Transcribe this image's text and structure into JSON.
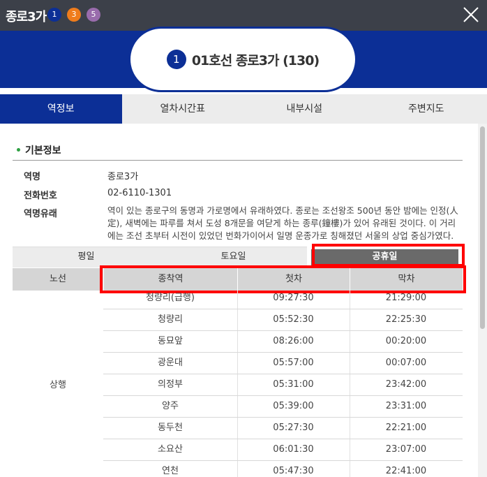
{
  "header": {
    "title": "종로3가",
    "lines": [
      {
        "label": "1",
        "color": "#0c2f96"
      },
      {
        "label": "3",
        "color": "#ef7c1c"
      },
      {
        "label": "5",
        "color": "#996cac"
      }
    ]
  },
  "banner": {
    "line_number": "1",
    "station_name": "01호선 종로3가 (130)"
  },
  "tabs": [
    "역정보",
    "열차시간표",
    "내부시설",
    "주변지도"
  ],
  "basic_info": {
    "section_title": "기본정보",
    "name_label": "역명",
    "name_value": "종로3가",
    "phone_label": "전화번호",
    "phone_value": "02-6110-1301",
    "origin_label": "역명유래",
    "origin_value": "역이 있는 종로구의 동명과 가로명에서 유래하였다. 종로는 조선왕조 500년 동안 밤에는 인정(人定), 새벽에는 파루를 쳐서 도성 8개문을 여닫게 하는 종루(鐘樓)가 있어 유래된 것이다. 이 거리에는 조선 초부터 시전이 있었던 번화가이어서 일명 운종가로 칭해졌던 서울의 상업 중심가였다."
  },
  "day_tabs": [
    "평일",
    "토요일",
    "공휴일"
  ],
  "timetable": {
    "headers": {
      "line": "노선",
      "destination": "종착역",
      "first": "첫차",
      "last": "막차"
    },
    "direction": "상행",
    "rows": [
      {
        "destination": "청량리(급행)",
        "first": "09:27:30",
        "last": "21:29:00"
      },
      {
        "destination": "청량리",
        "first": "05:52:30",
        "last": "22:25:30"
      },
      {
        "destination": "동묘앞",
        "first": "08:26:00",
        "last": "00:20:00"
      },
      {
        "destination": "광운대",
        "first": "05:57:00",
        "last": "00:07:00"
      },
      {
        "destination": "의정부",
        "first": "05:31:00",
        "last": "23:42:00"
      },
      {
        "destination": "양주",
        "first": "05:39:00",
        "last": "23:31:00"
      },
      {
        "destination": "동두천",
        "first": "05:27:30",
        "last": "22:21:00"
      },
      {
        "destination": "소요산",
        "first": "06:01:30",
        "last": "23:07:00"
      },
      {
        "destination": "연천",
        "first": "05:47:30",
        "last": "22:41:00"
      }
    ]
  },
  "colors": {
    "brand": "#0c2f96",
    "highlight": "#ff0000",
    "topbar": "#3c4049"
  }
}
